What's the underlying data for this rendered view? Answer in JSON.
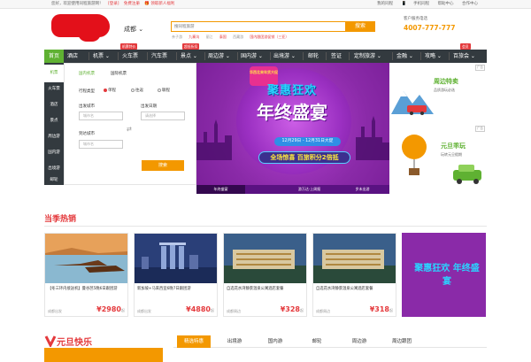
{
  "topbar": {
    "welcome": "您好，欢迎使用同程旅游网！",
    "login": "[登录]",
    "register": "免费注册",
    "member_offer": "领取新人福利",
    "links": [
      "我的同程",
      "手机同程",
      "帮助中心",
      "合作中心"
    ]
  },
  "header": {
    "city": "成都",
    "search_placeholder": "搜同程旅游",
    "search_button": "搜索",
    "hot_searches": [
      "亲子游",
      "九寨沟",
      "丽江",
      "泰国",
      "西藏游",
      "国内跟团游促销（三亚）"
    ],
    "service_label": "客户服务电话",
    "service_phone": "4007-777-777"
  },
  "nav": {
    "items": [
      "首页",
      "酒店",
      "机票",
      "火车票",
      "汽车票",
      "景点",
      "周边游",
      "国内游",
      "出境游",
      "邮轮",
      "签证",
      "定制旅游",
      "金融",
      "攻略",
      "百旅会"
    ],
    "badges": [
      "机票特价",
      "超低折扣",
      "会员"
    ]
  },
  "left_tabs": [
    "机票",
    "火车票",
    "酒店",
    "景点",
    "周边游",
    "国内游",
    "出境游",
    "邮轮"
  ],
  "booking": {
    "tab_domestic": "国内机票",
    "tab_international": "国际机票",
    "trip_type_label": "行程类型",
    "trip_types": [
      "单程",
      "往返",
      "联程"
    ],
    "depart_city_label": "出发城市",
    "depart_date_label": "出发日期",
    "arrive_city_label": "到达城市",
    "city_placeholder": "城市名",
    "date_placeholder": "请选择",
    "search_button": "搜索"
  },
  "banner": {
    "tag": "华西北来年货大促",
    "line1": "聚惠狂欢",
    "line2": "年终盛宴",
    "date": "12月29日 - 12月31日大促",
    "line3": "全场惊喜 百旅积分2倍抵",
    "tabs": [
      "年终盛宴",
      "游万达·上周报",
      "岁末出游"
    ]
  },
  "side_ads": [
    {
      "title": "周边特卖",
      "subtitle": "品质游玩必选",
      "tag": "广告"
    },
    {
      "title": "元旦乖玩",
      "subtitle": "玩转元旦假期",
      "tag": "广告"
    }
  ],
  "hot": {
    "title": "当季热销",
    "products": [
      {
        "desc": "【冬三环内接送机】曼谷芭5晚6日跟团游",
        "loc": "成都出发",
        "price": "¥2980",
        "unit": "起"
      },
      {
        "desc": "新加坡+马来西亚6晚7日跟团游",
        "loc": "成都出发",
        "price": "¥4880",
        "unit": "起"
      },
      {
        "desc": "自选花水湾静景温泉公寓酒店套餐",
        "loc": "成都周边",
        "price": "¥328",
        "unit": "起"
      },
      {
        "desc": "自选花水湾静景温泉公寓酒店套餐",
        "loc": "成都周边",
        "price": "¥318",
        "unit": "起"
      },
      {
        "desc": "聚惠狂欢 年终盛宴",
        "loc": "",
        "price": "",
        "unit": ""
      }
    ]
  },
  "bottom": {
    "section_title": "元旦快乐",
    "tabs": [
      "精选特惠",
      "出境游",
      "国内游",
      "邮轮",
      "周边游",
      "周边跟团"
    ]
  },
  "colors": {
    "accent": "#5fb132",
    "orange": "#f39800",
    "red": "#e4393c",
    "nav_bg": "#333a3f",
    "banner_bg": "#7a1c9d"
  }
}
